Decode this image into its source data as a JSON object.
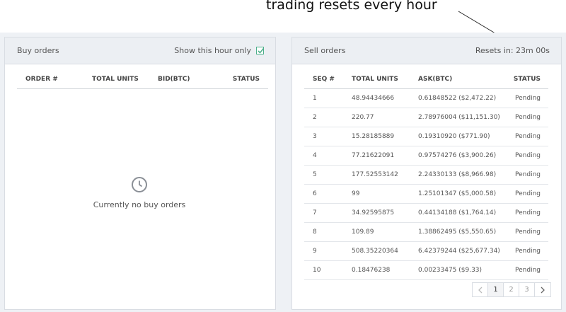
{
  "annotation": {
    "text": "trading resets every hour"
  },
  "buy_orders": {
    "title": "Buy orders",
    "show_hour_label": "Show this hour only",
    "show_hour_checked": true,
    "columns": [
      "ORDER #",
      "TOTAL UNITS",
      "BID(BTC)",
      "STATUS"
    ],
    "empty_icon": "clock-icon",
    "empty_text": "Currently no buy orders"
  },
  "sell_orders": {
    "title": "Sell orders",
    "resets_text": "Resets in: 23m 00s",
    "columns": [
      "SEQ #",
      "TOTAL UNITS",
      "ASK(BTC)",
      "STATUS"
    ],
    "rows": [
      {
        "seq": "1",
        "units": "48.94434666",
        "ask": "0.61848522 ($2,472.22)",
        "status": "Pending"
      },
      {
        "seq": "2",
        "units": "220.77",
        "ask": "2.78976004 ($11,151.30)",
        "status": "Pending"
      },
      {
        "seq": "3",
        "units": "15.28185889",
        "ask": "0.19310920 ($771.90)",
        "status": "Pending"
      },
      {
        "seq": "4",
        "units": "77.21622091",
        "ask": "0.97574276 ($3,900.26)",
        "status": "Pending"
      },
      {
        "seq": "5",
        "units": "177.52553142",
        "ask": "2.24330133 ($8,966.98)",
        "status": "Pending"
      },
      {
        "seq": "6",
        "units": "99",
        "ask": "1.25101347 ($5,000.58)",
        "status": "Pending"
      },
      {
        "seq": "7",
        "units": "34.92595875",
        "ask": "0.44134188 ($1,764.14)",
        "status": "Pending"
      },
      {
        "seq": "8",
        "units": "109.89",
        "ask": "1.38862495 ($5,550.65)",
        "status": "Pending"
      },
      {
        "seq": "9",
        "units": "508.35220364",
        "ask": "6.42379244 ($25,677.34)",
        "status": "Pending"
      },
      {
        "seq": "10",
        "units": "0.18476238",
        "ask": "0.00233475 ($9.33)",
        "status": "Pending"
      }
    ],
    "pagination": {
      "prev_icon": "chevron-left-icon",
      "pages": [
        "1",
        "2",
        "3"
      ],
      "current": "1",
      "next_icon": "chevron-right-icon"
    }
  },
  "colors": {
    "checkbox_accent": "#4caf8a",
    "header_bg": "#eceff3",
    "page_bg": "#eef1f5"
  }
}
